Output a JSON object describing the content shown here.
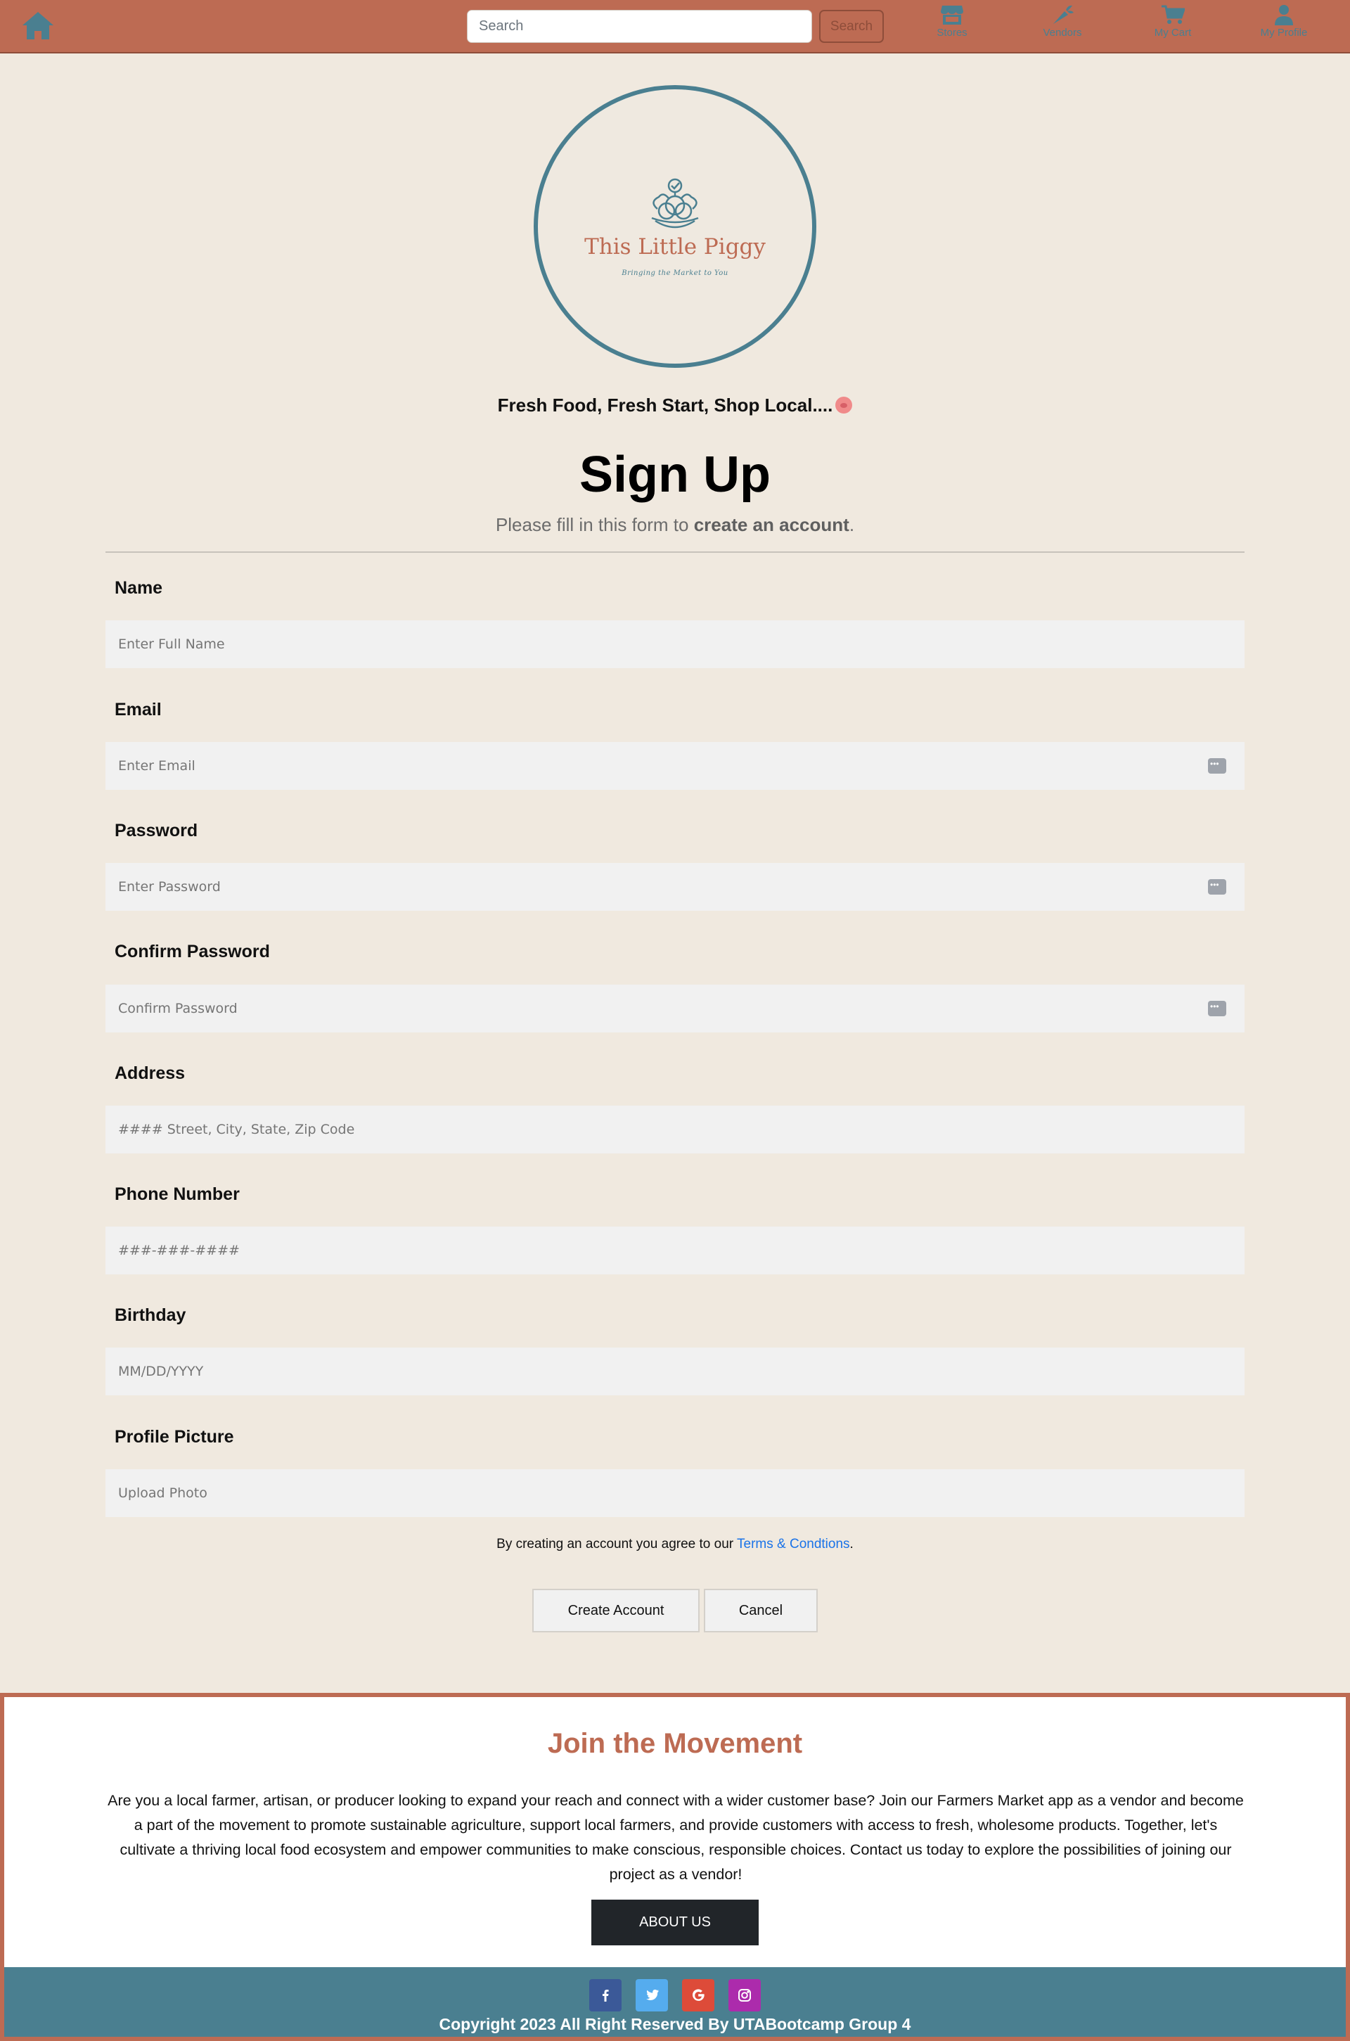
{
  "nav": {
    "search_placeholder": "Search",
    "search_button": "Search",
    "items": [
      {
        "label": "Stores",
        "icon": "store-icon"
      },
      {
        "label": "Vendors",
        "icon": "carrot-icon"
      },
      {
        "label": "My Cart",
        "icon": "cart-icon"
      },
      {
        "label": "My Profile",
        "icon": "user-icon"
      }
    ]
  },
  "logo": {
    "title": "This Little Piggy",
    "subtitle": "Bringing the Market to You"
  },
  "tagline": "Fresh Food, Fresh Start, Shop Local....",
  "form": {
    "title": "Sign Up",
    "subtitle_prefix": "Please fill in this form to ",
    "subtitle_bold": "create an account",
    "subtitle_suffix": ".",
    "fields": [
      {
        "label": "Name",
        "placeholder": "Enter Full Name"
      },
      {
        "label": "Email",
        "placeholder": "Enter Email"
      },
      {
        "label": "Password",
        "placeholder": "Enter Password"
      },
      {
        "label": "Confirm Password",
        "placeholder": "Confirm Password"
      },
      {
        "label": "Address",
        "placeholder": "#### Street, City, State, Zip Code"
      },
      {
        "label": "Phone Number",
        "placeholder": "###-###-####"
      },
      {
        "label": "Birthday",
        "placeholder": "MM/DD/YYYY"
      },
      {
        "label": "Profile Picture",
        "placeholder": "Upload Photo"
      }
    ],
    "terms_prefix": "By creating an account you agree to our ",
    "terms_link": "Terms & Condtions",
    "terms_suffix": ".",
    "create_button": "Create Account",
    "cancel_button": "Cancel"
  },
  "footer": {
    "title": "Join the Movement",
    "text": "Are you a local farmer, artisan, or producer looking to expand your reach and connect with a wider customer base? Join our Farmers Market app as a vendor and become a part of the movement to promote sustainable agriculture, support local farmers, and provide customers with access to fresh, wholesome products. Together, let's cultivate a thriving local food ecosystem and empower communities to make conscious, responsible choices. Contact us today to explore the possibilities of joining our project as a vendor!",
    "about_button": "ABOUT US",
    "copyright": "Copyright 2023 All Right Reserved By UTABootcamp Group 4",
    "socials": [
      "facebook-icon",
      "twitter-icon",
      "google-icon",
      "instagram-icon"
    ]
  },
  "colors": {
    "brand_terracotta": "#bd6b53",
    "brand_teal": "#4a7f90",
    "background": "#f0e9df",
    "facebook": "#3b5998",
    "twitter": "#55acee",
    "google": "#dd4b39",
    "instagram": "#ac2bac"
  }
}
